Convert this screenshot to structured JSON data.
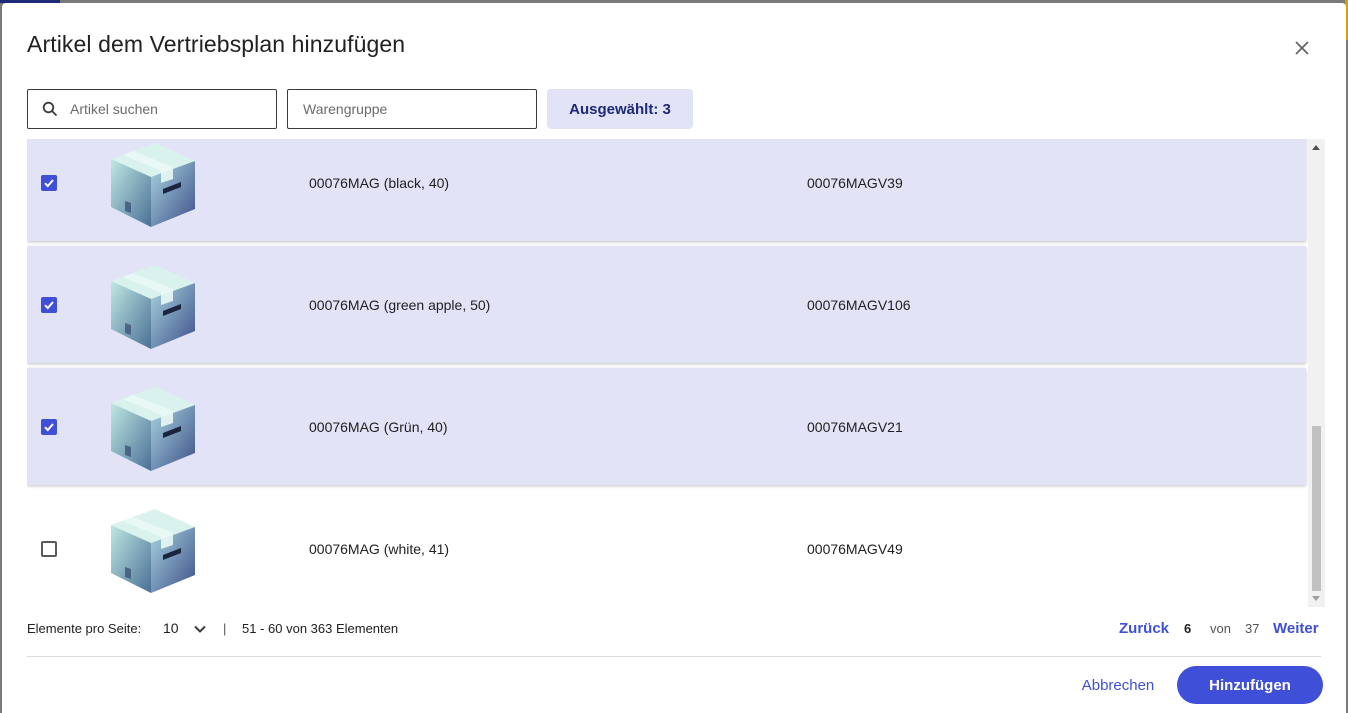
{
  "dialog": {
    "title": "Artikel dem Vertriebsplan hinzufügen",
    "close_icon": "close-icon"
  },
  "filters": {
    "search_placeholder": "Artikel suchen",
    "search_icon": "search-icon",
    "group_placeholder": "Warengruppe",
    "selected_label": "Ausgewählt: 3"
  },
  "items": [
    {
      "name": "00076MAG (black, 40)",
      "code": "00076MAGV39",
      "checked": true
    },
    {
      "name": "00076MAG (green apple, 50)",
      "code": "00076MAGV106",
      "checked": true
    },
    {
      "name": "00076MAG (Grün, 40)",
      "code": "00076MAGV21",
      "checked": true
    },
    {
      "name": "00076MAG (white, 41)",
      "code": "00076MAGV49",
      "checked": false
    }
  ],
  "pagination": {
    "per_page_label": "Elemente pro Seite:",
    "per_page_value": "10",
    "separator": "|",
    "range_text": "51 - 60 von 363 Elementen",
    "prev_label": "Zurück",
    "current_page": "6",
    "of_label": "von",
    "total_pages": "37",
    "next_label": "Weiter"
  },
  "footer": {
    "cancel_label": "Abbrechen",
    "add_label": "Hinzufügen"
  },
  "colors": {
    "accent": "#3f4fd8",
    "selected_row": "#e3e3f8",
    "chip_text": "#1e2a78"
  }
}
